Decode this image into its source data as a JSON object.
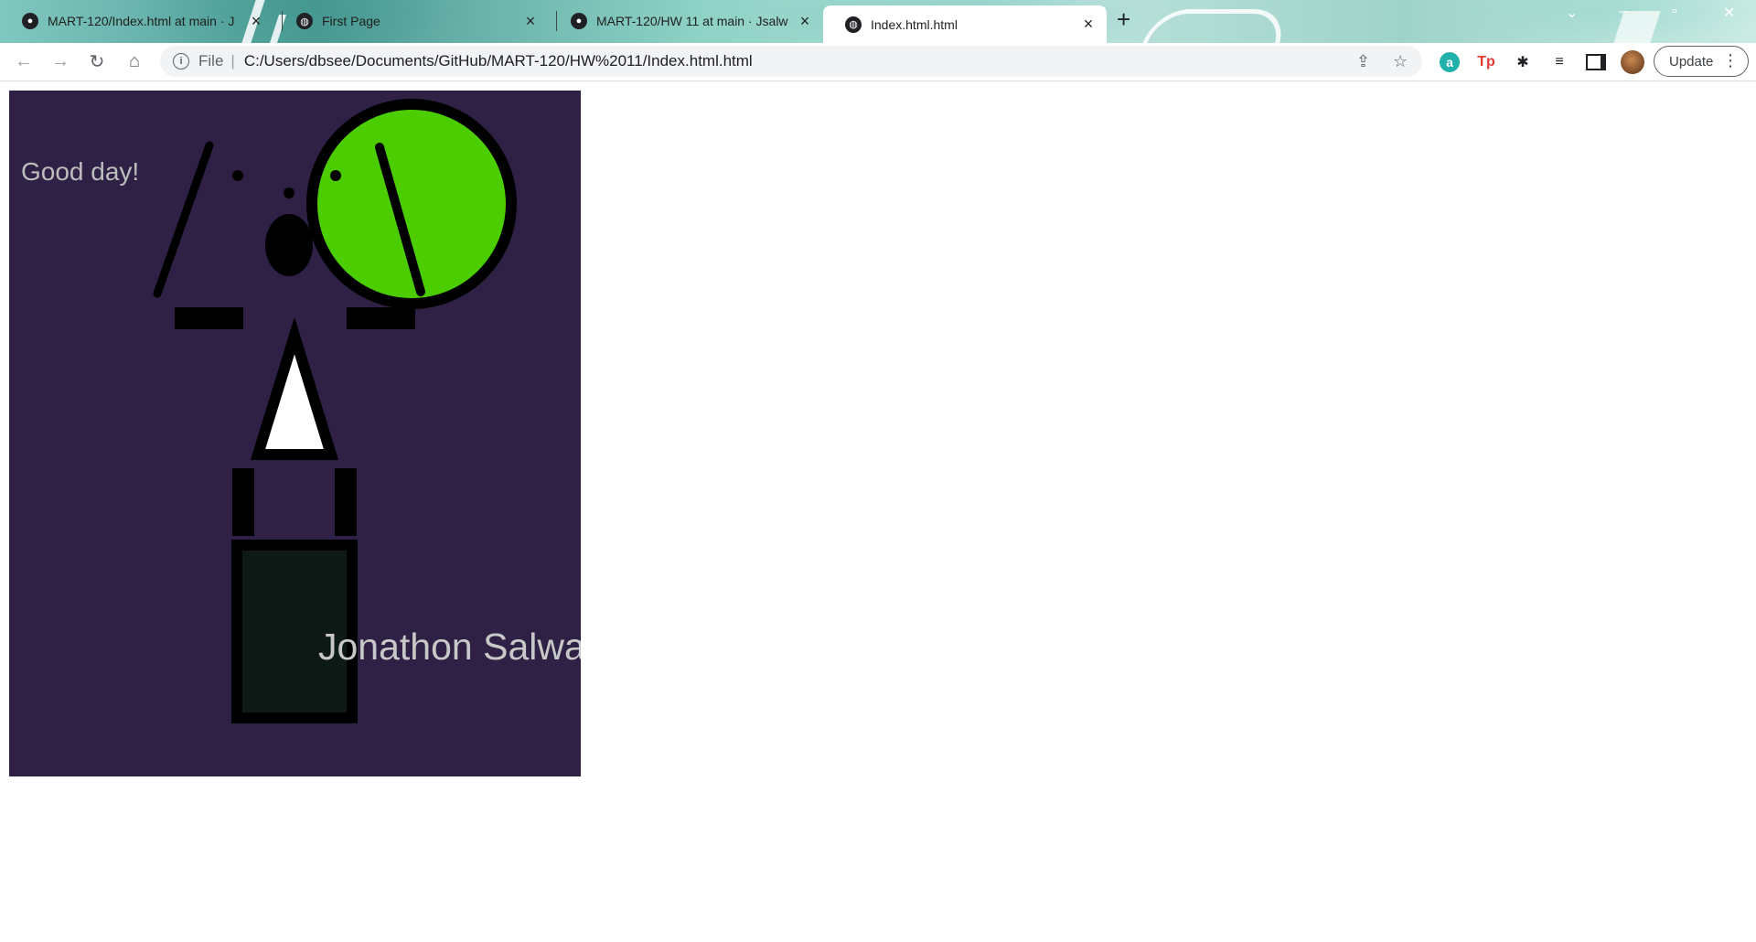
{
  "browser": {
    "tabs": [
      {
        "title": "MART-120/Index.html at main · J",
        "icon": "github-icon",
        "active": false
      },
      {
        "title": "First Page",
        "icon": "globe-icon",
        "active": false
      },
      {
        "title": "MART-120/HW 11 at main · Jsalw",
        "icon": "github-icon",
        "active": false
      },
      {
        "title": "Index.html.html",
        "icon": "globe-icon",
        "active": true
      }
    ],
    "address": {
      "chip": "File",
      "url": "C:/Users/dbsee/Documents/GitHub/MART-120/HW%2011/Index.html.html"
    },
    "update_label": "Update",
    "extensions": [
      "amazon-assistant-icon",
      "tp-extension-icon",
      "puzzle-extensions-icon",
      "reading-list-icon",
      "side-panel-icon",
      "profile-avatar"
    ]
  },
  "page": {
    "greeting": "Good day!",
    "author": "Jonathon Salwa",
    "colors": {
      "background": "#2e2145",
      "head_fill": "#4ccd00",
      "outline": "#000000",
      "triangle_fill": "#ffffff",
      "body_fill": "#0e1a16"
    }
  }
}
